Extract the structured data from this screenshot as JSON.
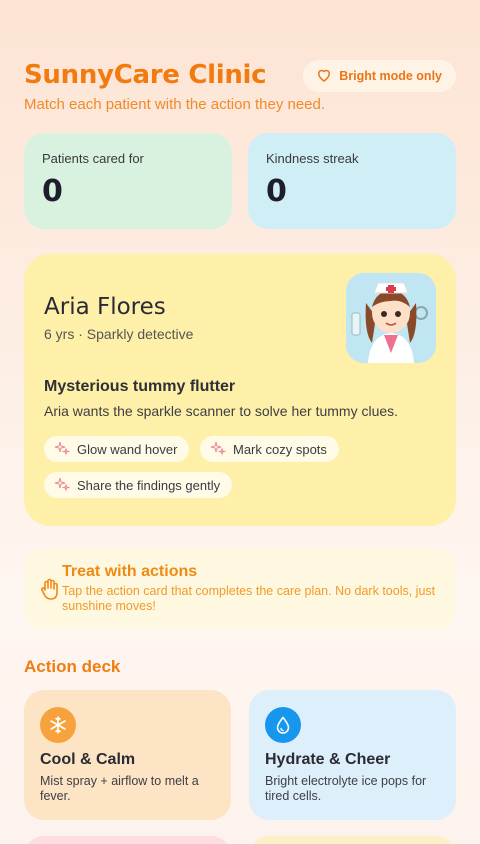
{
  "header": {
    "title": "SunnyCare Clinic",
    "subtitle": "Match each patient with the action they need.",
    "mode_label": "Bright mode only"
  },
  "stats": [
    {
      "label": "Patients cared for",
      "value": "0"
    },
    {
      "label": "Kindness streak",
      "value": "0"
    }
  ],
  "patient": {
    "name": "Aria Flores",
    "meta": "6 yrs · Sparkly detective",
    "case_title": "Mysterious tummy flutter",
    "case_desc": "Aria wants the sparkle scanner to solve her tummy clues.",
    "steps": [
      "Glow wand hover",
      "Mark cozy spots",
      "Share the findings gently"
    ]
  },
  "hint": {
    "title": "Treat with actions",
    "text": "Tap the action card that completes the care plan. No dark tools, just sunshine moves!"
  },
  "deck": {
    "title": "Action deck",
    "actions": [
      {
        "title": "Cool & Calm",
        "desc": "Mist spray + airflow to melt a fever.",
        "icon": "snowflake-icon"
      },
      {
        "title": "Hydrate & Cheer",
        "desc": "Bright electrolyte ice pops for tired cells.",
        "icon": "droplet-icon"
      }
    ]
  },
  "colors": {
    "accent": "#f27b0f",
    "patients_card": "#d8f2df",
    "streak_card": "#cfeef6",
    "patient_card": "#fef0a8"
  }
}
